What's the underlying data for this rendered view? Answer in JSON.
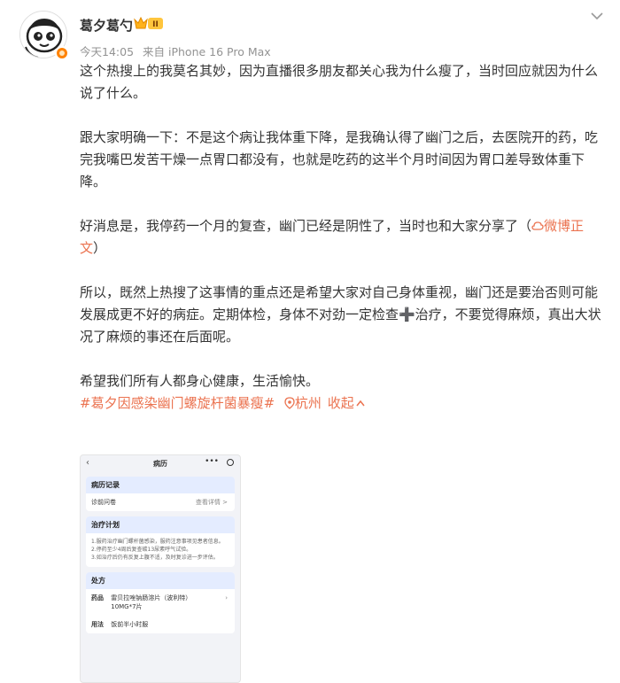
{
  "post": {
    "username": "葛夕葛勺",
    "vip_label": "II",
    "time": "今天14:05",
    "source": "来自 iPhone 16 Pro Max",
    "paragraphs": [
      "这个热搜上的我莫名其妙，因为直播很多朋友都关心我为什么瘦了，当时回应就因为什么说了什么。",
      "跟大家明确一下：不是这个病让我体重下降，是我确认得了幽门之后，去医院开的药，吃完我嘴巴发苦干燥一点胃口都没有，也就是吃药的这半个月时间因为胃口差导致体重下降。",
      "好消息是，我停药一个月的复查，幽门已经是阴性了，当时也和大家分享了（",
      "所以，既然上热搜了这事情的重点还是希望大家对自己身体重视，幽门还是要治否则可能发展成更不好的病症。定期体检，身体不对劲一定检查➕治疗，不要觉得麻烦，真出大状况了麻烦的事还在后面呢。",
      "希望我们所有人都身心健康，生活愉快。"
    ],
    "para3_link": "微博正文",
    "para3_end": "）",
    "hashtag": "#葛夕因感染幽门螺旋杆菌暴瘦#",
    "location": "杭州",
    "collapse": "收起"
  },
  "screenshot": {
    "title": "病历",
    "record_header": "病历记录",
    "record_row_label": "诊前问卷",
    "record_row_action": "查看详情 >",
    "plan_header": "治疗计划",
    "plan_items": [
      "1.服药治疗幽门螺杆菌感染，服药注意事项见患者信息。",
      "2.停药至少4周后复查碳13尿素呼气试验。",
      "3.如治疗后仍有反复上腹不适，及时复诊进一步评估。"
    ],
    "rx_header": "处方",
    "drug_label": "药品",
    "drug_name": "雷贝拉唑钠肠溶片（波利特）",
    "drug_spec": "10MG*7片",
    "usage_label": "用法",
    "usage_value": "饭前半小时服"
  },
  "colors": {
    "link": "#eb7350",
    "meta": "#939393",
    "badge": "#ff8200"
  }
}
